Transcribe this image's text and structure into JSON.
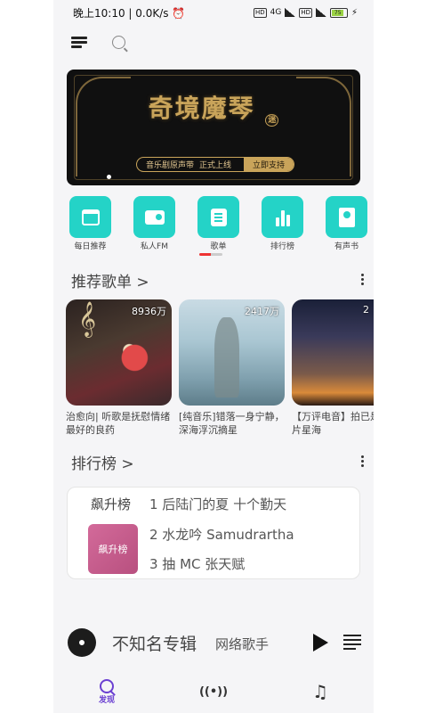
{
  "status": {
    "time": "晚上10:10",
    "speed": "0.0K/s",
    "alarm_icon": "alarm-icon",
    "network": "4G",
    "battery": "75"
  },
  "banner": {
    "title": "奇境魔琴",
    "title_badge": "迷",
    "subtitle": "音乐剧原声带",
    "release": "正式上线",
    "action": "立即支持"
  },
  "quick_actions": [
    {
      "label": "每日推荐",
      "icon": "calendar-icon"
    },
    {
      "label": "私人FM",
      "icon": "radio-icon"
    },
    {
      "label": "歌单",
      "icon": "playlist-icon"
    },
    {
      "label": "排行榜",
      "icon": "chart-bars-icon"
    },
    {
      "label": "有声书",
      "icon": "book-icon"
    }
  ],
  "recommend": {
    "title": "推荐歌单 >",
    "items": [
      {
        "count": "8936万",
        "title": "治愈向| 听歌是抚慰情绪最好的良药"
      },
      {
        "count": "2417万",
        "title": "[纯音乐]错落一身宁静，深海浮沉摘星"
      },
      {
        "count": "2",
        "title": "【万评电音】拍已是一片星海"
      }
    ]
  },
  "ranking": {
    "title": "排行榜 >",
    "chart": {
      "name": "飙升榜",
      "cover_text": "飙升榜",
      "songs": [
        "1 后陆门的夏  十个勤天",
        "2 水龙吟 Samudrartha",
        "3 抽  MC 张天赋"
      ]
    }
  },
  "player": {
    "title": "不知名专辑",
    "artist": "网络歌手"
  },
  "tabs": [
    {
      "label": "发现",
      "icon": "discover-icon",
      "active": true
    },
    {
      "label": "",
      "icon": "radio-wave-icon"
    },
    {
      "label": "",
      "icon": "music-note-icon"
    }
  ],
  "colors": {
    "accent": "#24d3c7",
    "tab_active": "#6a3fd1",
    "banner_gold": "#c9a45a"
  }
}
